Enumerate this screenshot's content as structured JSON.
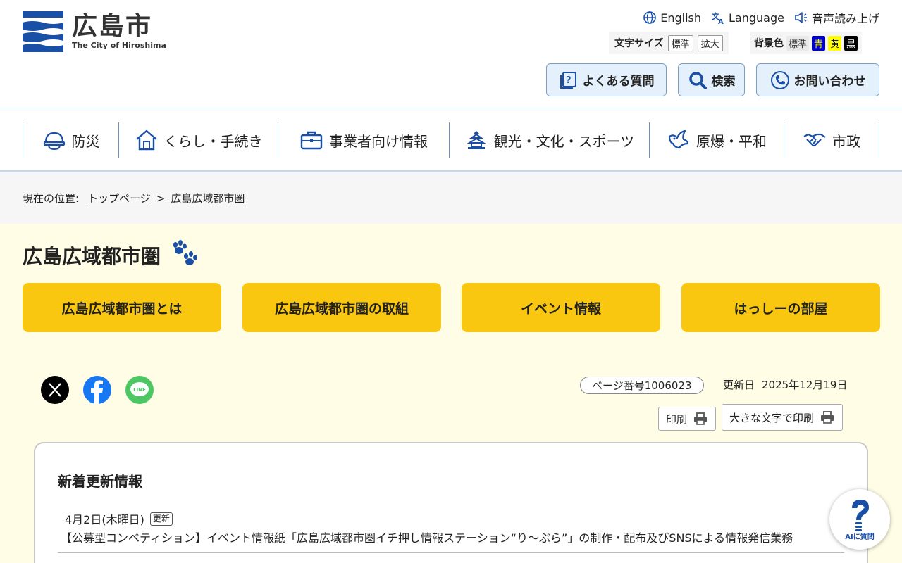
{
  "header": {
    "logo_title": "広島市",
    "logo_sub": "The City of Hiroshima",
    "util": [
      {
        "label": "English",
        "icon": "globe-icon"
      },
      {
        "label": "Language",
        "icon": "translate-icon"
      },
      {
        "label": "音声読み上げ",
        "icon": "speaker-icon"
      }
    ],
    "font_size_label": "文字サイズ",
    "font_std": "標準",
    "font_large": "拡大",
    "bg_label": "背景色",
    "bg_std": "標準",
    "bg_blue": "青",
    "bg_yellow": "黄",
    "bg_black": "黒",
    "faq": "よくある質問",
    "search": "検索",
    "contact": "お問い合わせ"
  },
  "nav": {
    "items": [
      {
        "label": "防災",
        "icon": "helmet-icon"
      },
      {
        "label": "くらし・手続き",
        "icon": "house-icon"
      },
      {
        "label": "事業者向け情報",
        "icon": "briefcase-icon"
      },
      {
        "label": "観光・文化・スポーツ",
        "icon": "castle-icon"
      },
      {
        "label": "原爆・平和",
        "icon": "dove-icon"
      },
      {
        "label": "市政",
        "icon": "handshake-icon"
      }
    ]
  },
  "breadcrumb": {
    "prefix": "現在の位置:",
    "home": "トップページ",
    "sep": ">",
    "current": "広島広域都市圏"
  },
  "main": {
    "title": "広島広域都市圏",
    "buttons": [
      "広島広域都市圏とは",
      "広島広域都市圏の取組",
      "イベント情報",
      "はっしーの部屋"
    ],
    "page_number": "ページ番号1006023",
    "updated_label": "更新日",
    "updated_date": "2025年12月19日",
    "print": "印刷",
    "print_large": "大きな文字で印刷"
  },
  "news": {
    "title": "新着更新情報",
    "items": [
      {
        "date": "4月2日(木曜日)",
        "badge": "更新",
        "text": "【公募型コンペティション】イベント情報紙「広島広域都市圏イチ押し情報ステーション“り～ぷら”」の制作・配布及びSNSによる情報発信業務"
      }
    ]
  },
  "ai_button": "AIに質問",
  "colors": {
    "brand_blue": "#1a4fa8",
    "yellow_button": "#f9c70f",
    "main_bg": "#fffde6",
    "header_button_bg": "#e4f0fb"
  }
}
